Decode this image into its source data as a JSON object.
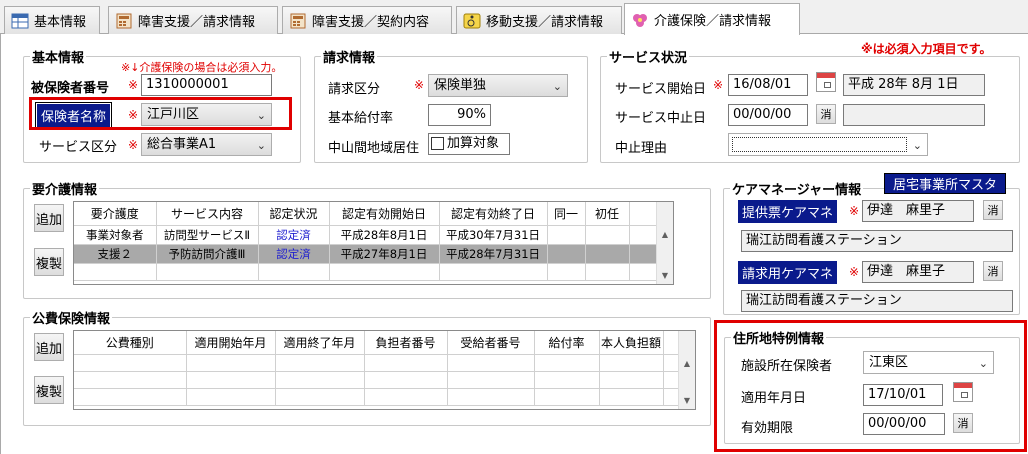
{
  "tabs": [
    {
      "label": "基本情報"
    },
    {
      "label": "障害支援／請求情報"
    },
    {
      "label": "障害支援／契約内容"
    },
    {
      "label": "移動支援／請求情報"
    },
    {
      "label": "介護保険／請求情報"
    }
  ],
  "basic": {
    "title": "基本情報",
    "note": "※↓介護保険の場合は必須入力。",
    "insured_label": "被保険者番号",
    "insured_value": "1310000001",
    "insurer_label": "保険者名称",
    "insurer_value": "江戸川区",
    "service_type_label": "サービス区分",
    "service_type_value": "総合事業A1"
  },
  "billing": {
    "title": "請求情報",
    "billing_type_label": "請求区分",
    "billing_type_value": "保険単独",
    "benefit_rate_label": "基本給付率",
    "benefit_rate_value": "90%",
    "mountain_label": "中山間地域居住",
    "mountain_checkbox_label": "加算対象"
  },
  "service_status": {
    "title": "サービス状況",
    "required_note": "※は必須入力項目です。",
    "start_label": "サービス開始日",
    "start_value": "16/08/01",
    "start_display": "平成 28年 8月 1日",
    "stop_label": "サービス中止日",
    "stop_value": "00/00/00",
    "clear_label": "消",
    "reason_label": "中止理由",
    "reason_value": ""
  },
  "care_level": {
    "title": "要介護情報",
    "add_label": "追加",
    "copy_label": "複製",
    "columns": [
      "要介護度",
      "サービス内容",
      "認定状況",
      "認定有効開始日",
      "認定有効終了日",
      "同一",
      "初任"
    ],
    "rows": [
      [
        "事業対象者",
        "訪問型サービスⅡ",
        "認定済",
        "平成28年8月1日",
        "平成30年7月31日",
        "",
        ""
      ],
      [
        "支援２",
        "予防訪問介護Ⅲ",
        "認定済",
        "平成27年8月1日",
        "平成28年7月31日",
        "",
        ""
      ]
    ]
  },
  "care_manager": {
    "title": "ケアマネージャー情報",
    "master_button": "居宅事業所マスタ",
    "provide_label": "提供票ケアマネ",
    "provide_name": "伊達　麻里子",
    "provide_office": "瑞江訪問看護ステーション",
    "billing_label": "請求用ケアマネ",
    "billing_name": "伊達　麻里子",
    "billing_office": "瑞江訪問看護ステーション",
    "clear_label": "消"
  },
  "public_expense": {
    "title": "公費保険情報",
    "add_label": "追加",
    "copy_label": "複製",
    "columns": [
      "公費種別",
      "適用開始年月",
      "適用終了年月",
      "負担者番号",
      "受給者番号",
      "給付率",
      "本人負担額"
    ]
  },
  "address_special": {
    "title": "住所地特例情報",
    "facility_label": "施設所在保険者",
    "facility_value": "江東区",
    "apply_label": "適用年月日",
    "apply_value": "17/10/01",
    "expiry_label": "有効期限",
    "expiry_value": "00/00/00",
    "clear_label": "消"
  },
  "required_mark": "※"
}
